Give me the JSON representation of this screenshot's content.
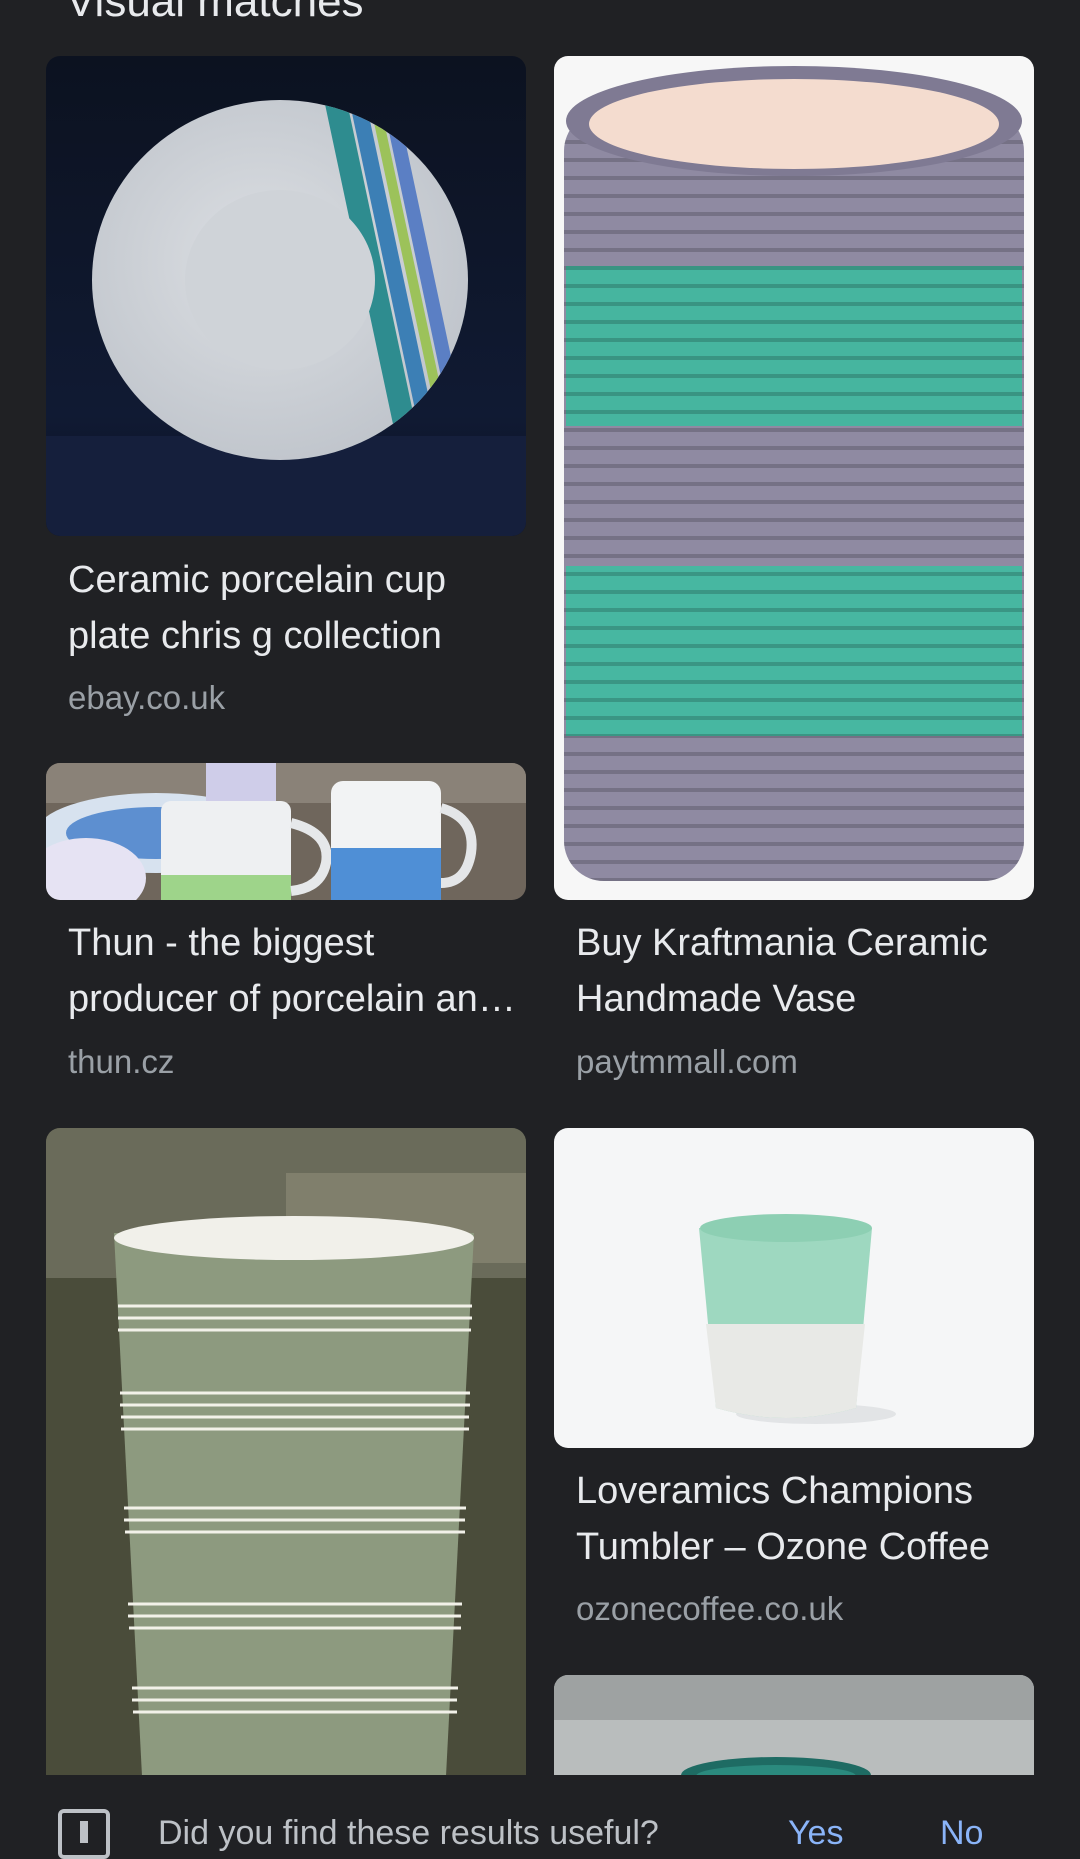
{
  "section": {
    "title": "Visual matches"
  },
  "results": [
    {
      "title": "Ceramic porcelain cup plate chris g collection",
      "source": "ebay.co.uk",
      "image": "white-plate-with-blue-green-stripes"
    },
    {
      "title": "Thun - the biggest producer of porcelain and ceramics",
      "source": "thun.cz",
      "image": "white-mugs-with-blue-and-green-bands"
    },
    {
      "title": "Buy Kraftmania Ceramic Handmade Vase",
      "source": "paytmmall.com",
      "image": "striped-purple-teal-ceramic-vase"
    },
    {
      "title": "Loveramics Champions Tumbler – Ozone Coffee",
      "source": "ozonecoffee.co.uk",
      "image": "mint-ceramic-tumbler"
    },
    {
      "title": "",
      "source": "",
      "image": "green-striped-ceramic-cup"
    },
    {
      "title": "",
      "source": "",
      "image": "teal-ceramic-bowl"
    }
  ],
  "feedback": {
    "question": "Did you find these results useful?",
    "yes_label": "Yes",
    "no_label": "No"
  },
  "colors": {
    "background": "#202124",
    "title_text": "#e8eaed",
    "source_text": "#9aa0a6",
    "link_blue": "#8ab4f8"
  }
}
